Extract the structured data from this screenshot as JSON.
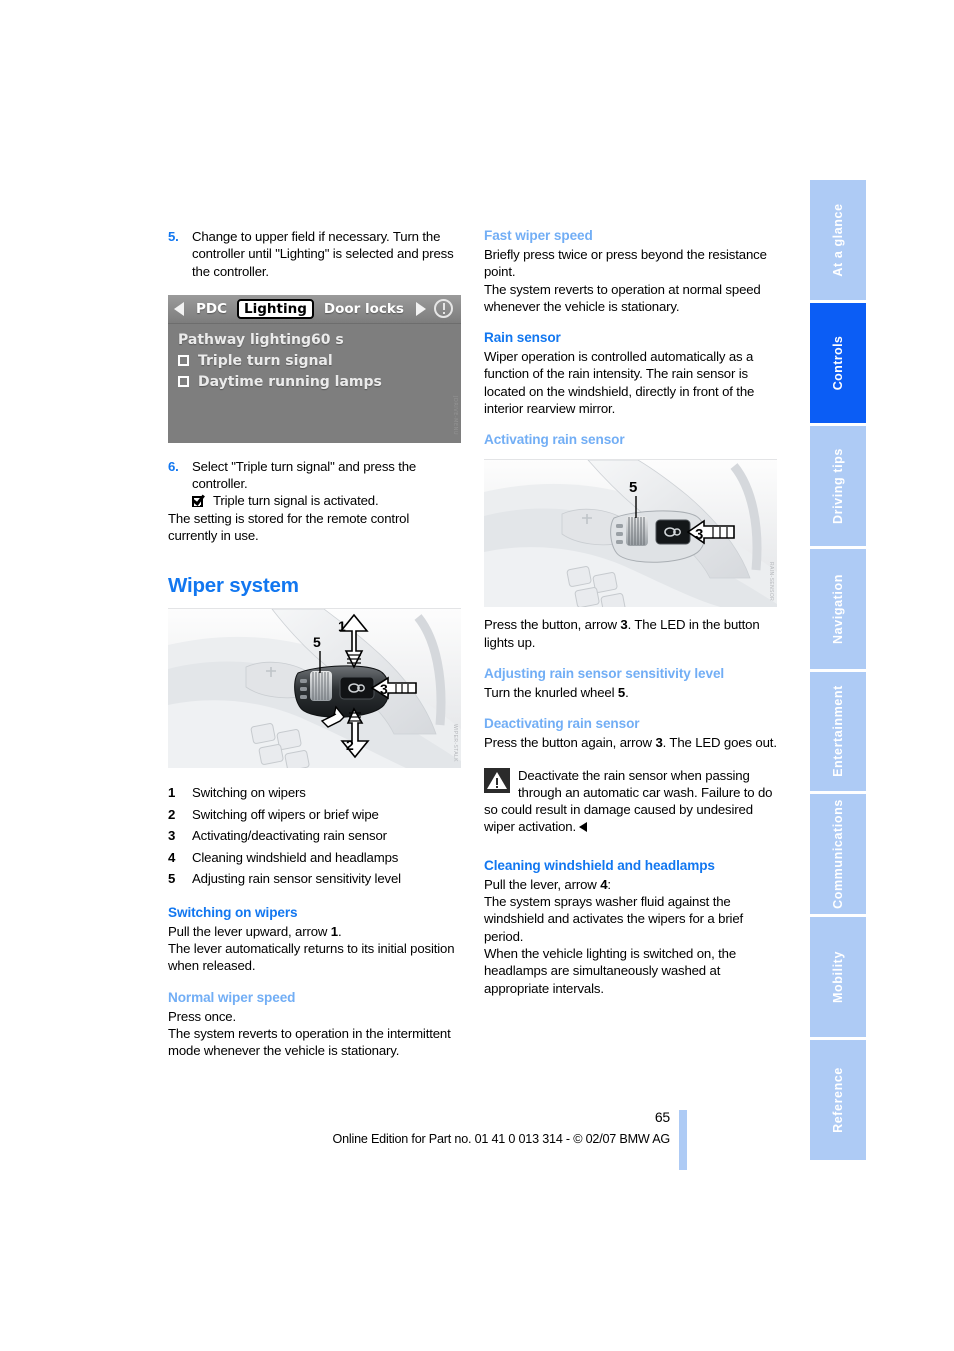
{
  "page": {
    "number": "65",
    "footer_note": "Online Edition for Part no. 01 41 0 013 314 - © 02/07 BMW AG",
    "accent_blue": "#1277f0",
    "subhead_blue": "#72aef5",
    "tab_blue": "#aecbf5",
    "tab_active_blue": "#0b5df5"
  },
  "side_tabs": [
    {
      "label": "At a glance",
      "active": false
    },
    {
      "label": "Controls",
      "active": true
    },
    {
      "label": "Driving tips",
      "active": false
    },
    {
      "label": "Navigation",
      "active": false
    },
    {
      "label": "Entertainment",
      "active": false
    },
    {
      "label": "Communications",
      "active": false
    },
    {
      "label": "Mobility",
      "active": false
    },
    {
      "label": "Reference",
      "active": false
    }
  ],
  "left_column": {
    "step5": {
      "number": "5.",
      "text": "Change to upper field if necessary. Turn the controller until \"Lighting\" is selected and press the controller."
    },
    "idrive_screen": {
      "nav_prev_icon": "triangle-left-icon",
      "nav_next_icon": "triangle-right-icon",
      "info_icon": "info-circle-icon",
      "menu_items": [
        "PDC",
        "Lighting",
        "Door locks"
      ],
      "selected_menu_item": "Lighting",
      "rows": [
        {
          "type": "value",
          "label": "Pathway lighting",
          "value": "60 s"
        },
        {
          "type": "checkbox",
          "label": "Triple turn signal",
          "checked": false
        },
        {
          "type": "checkbox",
          "label": "Daytime running lamps",
          "checked": false
        }
      ],
      "watermark": "JDRIVE-MENU"
    },
    "step6": {
      "number": "6.",
      "text": "Select \"Triple turn signal\" and press the controller.",
      "result_icon": "checkbox-checked-icon",
      "result_text": "Triple turn signal is activated."
    },
    "after_step_text": "The setting is stored for the remote control currently in use.",
    "heading": "Wiper system",
    "wiper_photo": {
      "alt": "Steering column wiper stalk with callout arrows 1, 2, 3 and knurled wheel 5",
      "callouts": [
        "1",
        "2",
        "3",
        "5"
      ],
      "watermark": "WIPER-STALK"
    },
    "legend": [
      {
        "num": "1",
        "label": "Switching on wipers"
      },
      {
        "num": "2",
        "label": "Switching off wipers or brief wipe"
      },
      {
        "num": "3",
        "label": "Activating/deactivating rain sensor"
      },
      {
        "num": "4",
        "label": "Cleaning windshield and headlamps"
      },
      {
        "num": "5",
        "label": "Adjusting rain sensor sensitivity level"
      }
    ],
    "switching_on": {
      "heading": "Switching on wipers",
      "p1_a": "Pull the lever upward, arrow ",
      "p1_b": "1",
      "p1_c": ".",
      "p2": "The lever automatically returns to its initial position when released."
    },
    "normal_speed": {
      "heading": "Normal wiper speed",
      "p1": "Press once.",
      "p2": "The system reverts to operation in the intermittent mode whenever the vehicle is stationary."
    }
  },
  "right_column": {
    "fast_speed": {
      "heading": "Fast wiper speed",
      "p1": "Briefly press twice or press beyond the resistance point.",
      "p2": "The system reverts to operation at normal speed whenever the vehicle is stationary."
    },
    "rain_sensor": {
      "heading": "Rain sensor",
      "p1": "Wiper operation is controlled automatically as a function of the rain intensity. The rain sensor is located on the windshield, directly in front of the interior rearview mirror."
    },
    "activating": {
      "heading": "Activating rain sensor",
      "photo": {
        "alt": "Steering column stalk showing rain sensor button arrow 3 and knurled wheel 5",
        "callouts": [
          "3",
          "5"
        ],
        "watermark": "RAIN-SENSOR"
      },
      "p1_a": "Press the button, arrow ",
      "p1_b": "3",
      "p1_c": ". The LED in the button lights up."
    },
    "adjusting": {
      "heading": "Adjusting rain sensor sensitivity level",
      "p1_a": "Turn the knurled wheel ",
      "p1_b": "5",
      "p1_c": "."
    },
    "deactivating": {
      "heading": "Deactivating rain sensor",
      "p1_a": "Press the button again, arrow ",
      "p1_b": "3",
      "p1_c": ". The LED goes out."
    },
    "warning": {
      "icon": "warning-triangle-icon",
      "text": "Deactivate the rain sensor when passing through an automatic car wash. Failure to do so could result in damage caused by undesired wiper activation.",
      "end_marker_icon": "triangle-left-end-icon"
    },
    "cleaning": {
      "heading": "Cleaning windshield and headlamps",
      "p1_a": "Pull the lever, arrow ",
      "p1_b": "4",
      "p1_c": ":",
      "p2": "The system sprays washer fluid against the windshield and activates the wipers for a brief period.",
      "p3": "When the vehicle lighting is switched on, the headlamps are simultaneously washed at appropriate intervals."
    }
  }
}
